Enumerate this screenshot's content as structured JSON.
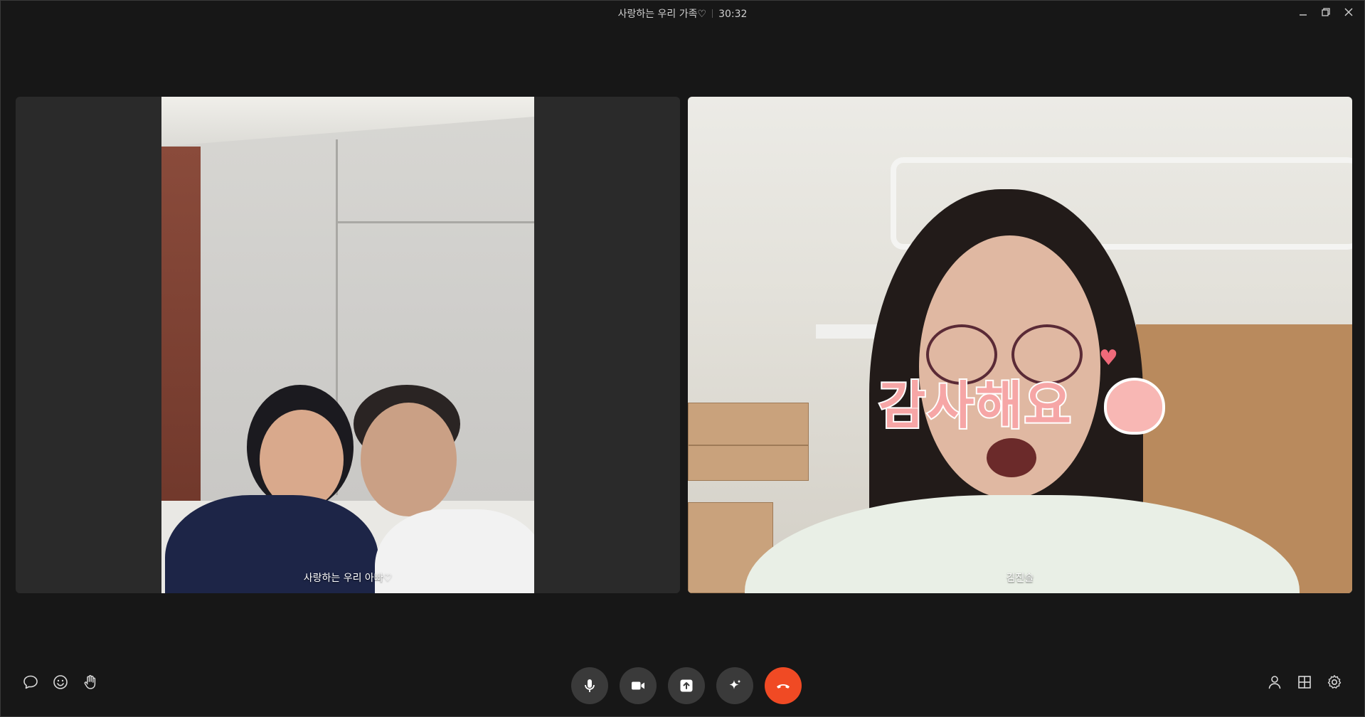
{
  "window": {
    "title": "사랑하는 우리 가족♡",
    "call_duration": "30:32"
  },
  "participants": [
    {
      "name": "사랑하는 우리 아빠♡"
    },
    {
      "name": "김진솔",
      "sticker_text": "감사해요"
    }
  ],
  "icons": {
    "minimize": "minimize-icon",
    "restore": "restore-icon",
    "close": "close-icon",
    "chat": "chat-bubble-icon",
    "emoji": "smiley-icon",
    "raise_hand": "hand-icon",
    "mic": "microphone-icon",
    "camera": "video-camera-icon",
    "share": "share-screen-icon",
    "effects": "sparkle-icon",
    "end_call": "hang-up-icon",
    "participants": "person-icon",
    "layout": "grid-icon",
    "settings": "gear-icon"
  },
  "colors": {
    "background": "#171717",
    "tile_background": "#2a2a2a",
    "control_button": "#3a3a3a",
    "end_call": "#f04a24"
  }
}
